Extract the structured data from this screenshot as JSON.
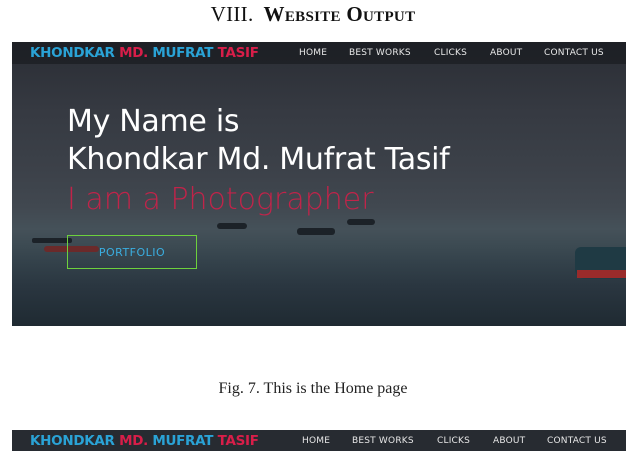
{
  "section": {
    "number": "VIII.",
    "title_w1_cap": "W",
    "title_w1_rest": "EBSITE",
    "title_w2_cap": "O",
    "title_w2_rest": "UTPUT"
  },
  "site": {
    "brand": {
      "part1": "KHONDKAR",
      "part2": "MD.",
      "part3": "MUFRAT",
      "part4": "TASIF"
    },
    "nav": [
      "HOME",
      "BEST WORKS",
      "CLICKS",
      "ABOUT",
      "CONTACT US"
    ],
    "hero": {
      "line1": "My Name is",
      "line2": "Khondkar Md. Mufrat Tasif",
      "line3": "I am a Photographer",
      "button": "PORTFOLIO"
    }
  },
  "caption": "Fig. 7.  This is the Home page",
  "colors": {
    "brand_blue": "#2aa3d6",
    "brand_red": "#d81e49",
    "button_border": "#6dd13d"
  }
}
